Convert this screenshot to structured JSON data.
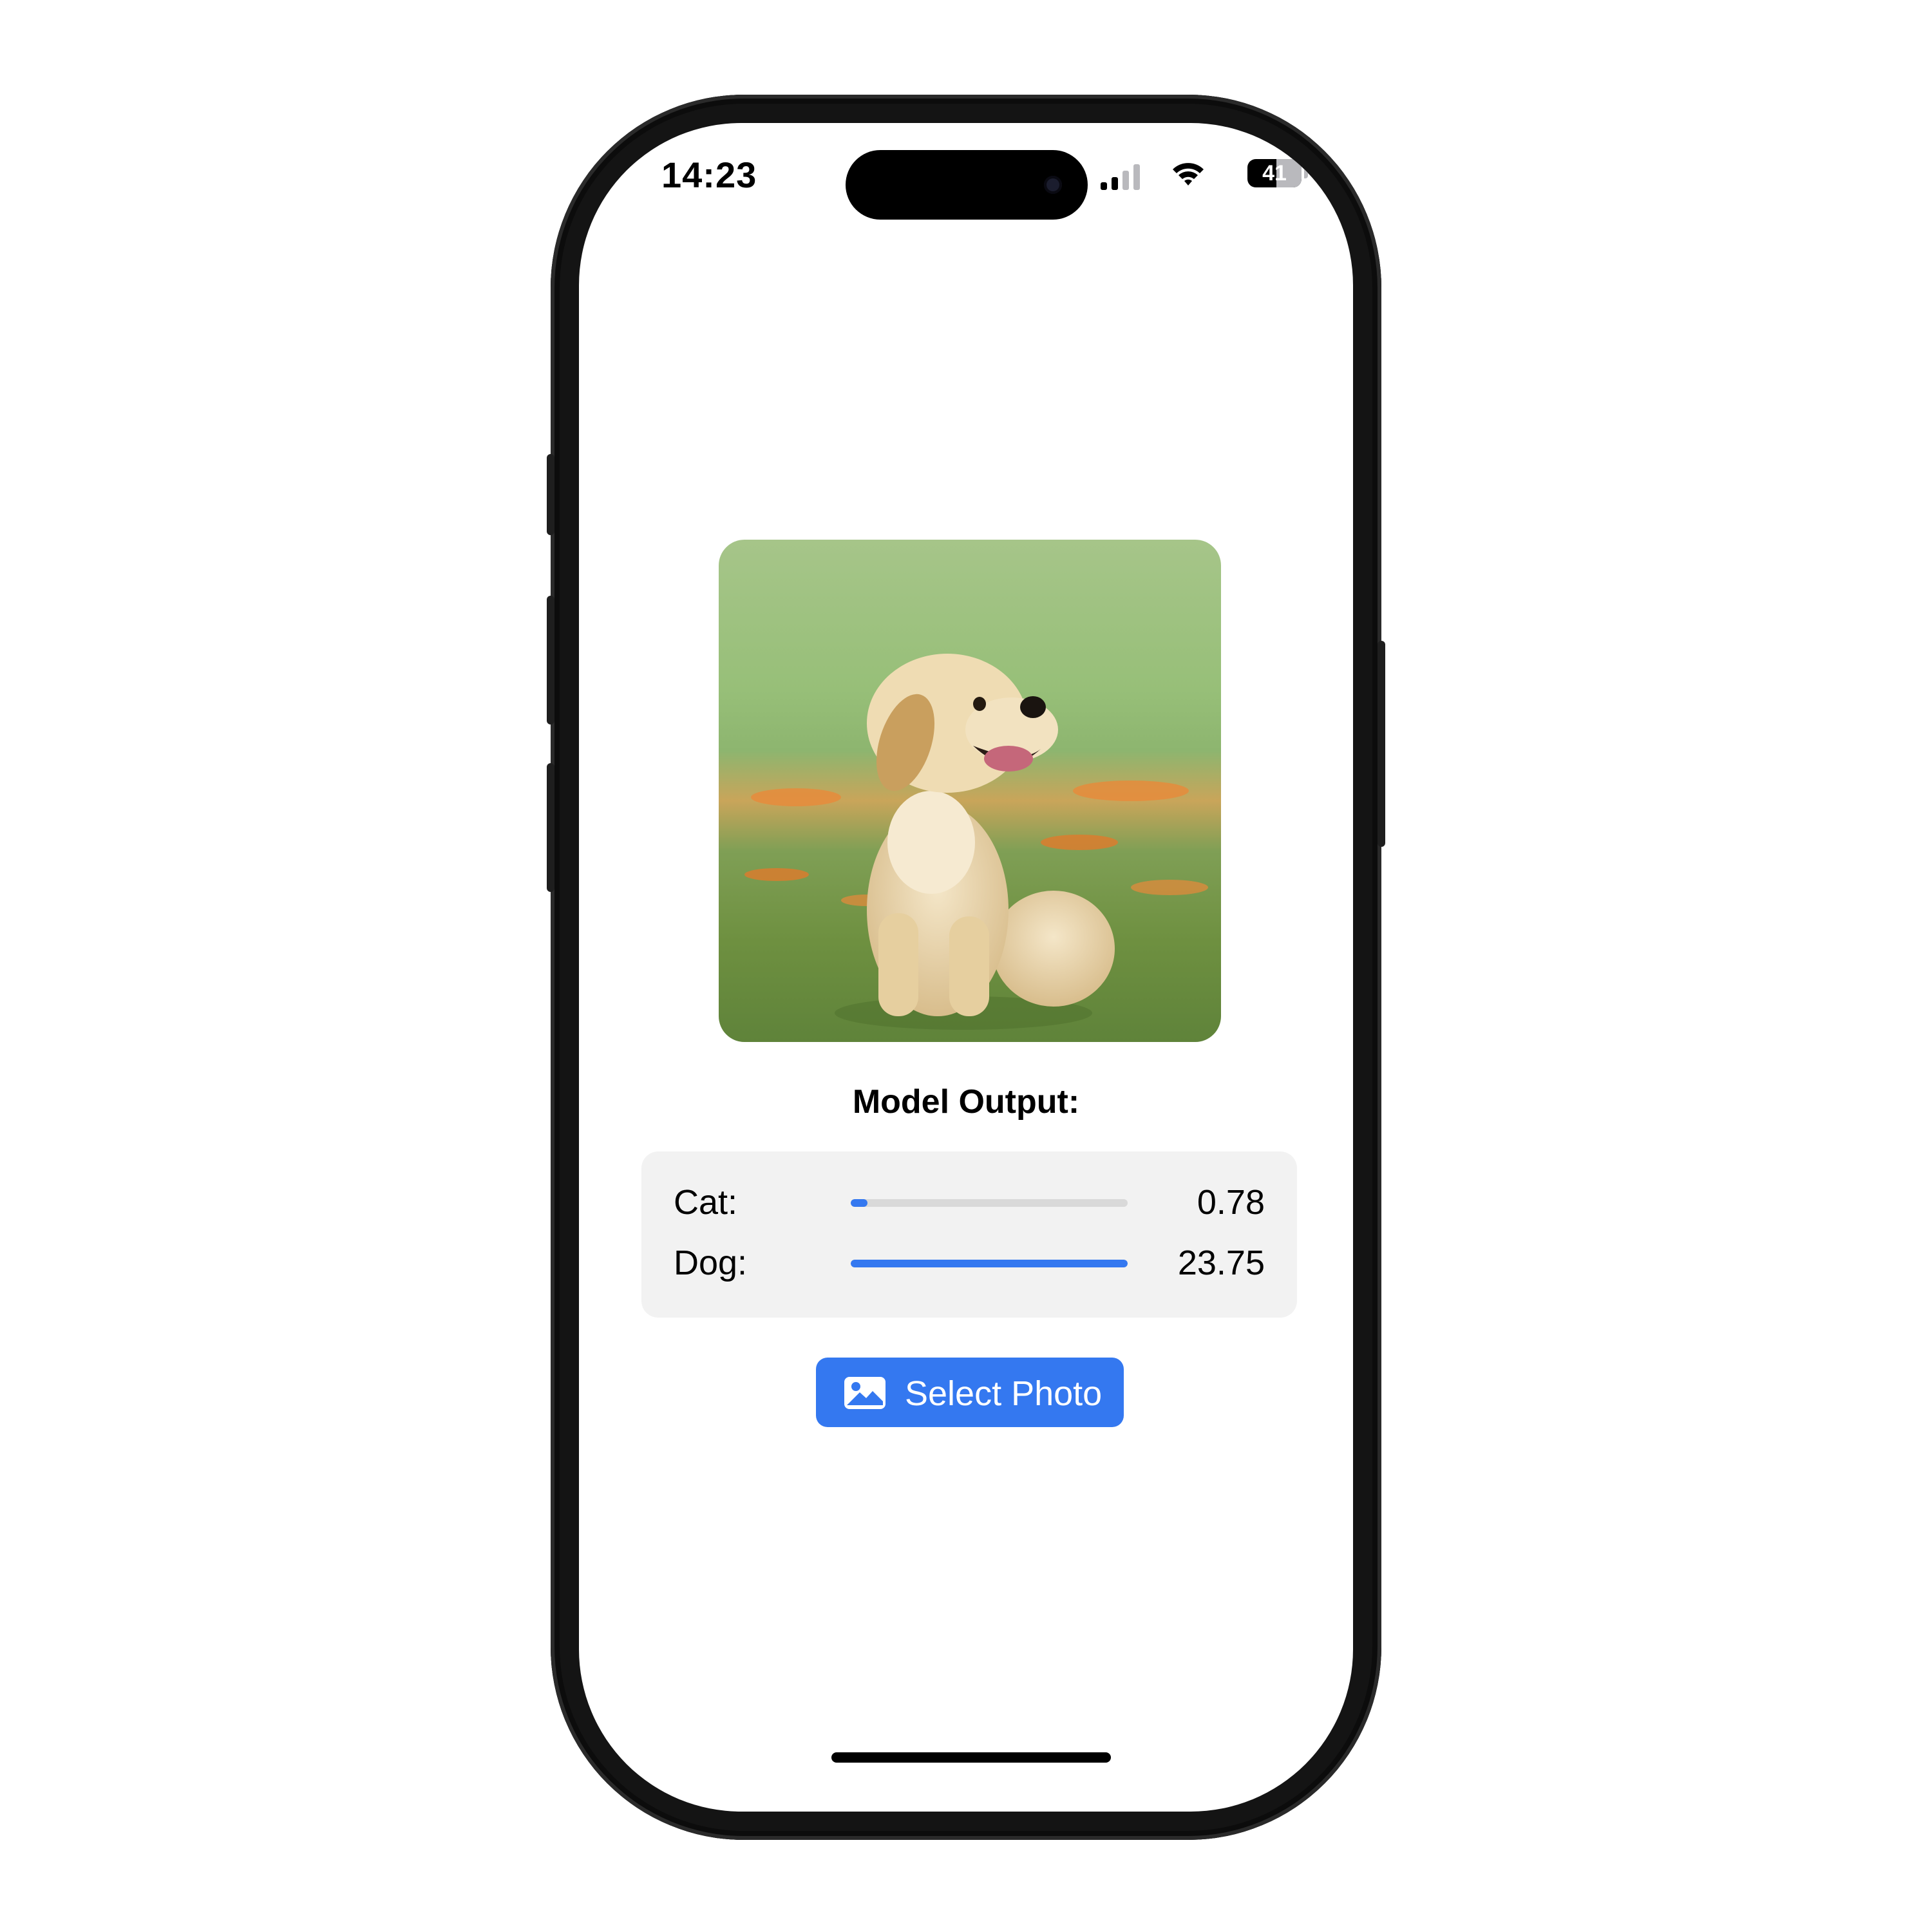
{
  "status_bar": {
    "time": "14:23",
    "battery": "41",
    "icons": [
      "cellular-signal-icon",
      "wifi-icon",
      "battery-icon"
    ]
  },
  "photo": {
    "icon": "puppy-photo",
    "description_visible": false
  },
  "model_output": {
    "title": "Model Output:",
    "results": [
      {
        "label": "Cat:",
        "value": "0.78",
        "fraction": 0.06
      },
      {
        "label": "Dog:",
        "value": "23.75",
        "fraction": 1.0
      }
    ]
  },
  "select_button": {
    "label": "Select Photo",
    "icon": "photo-icon"
  },
  "colors": {
    "accent": "#3478f0",
    "track": "#d9d9d9",
    "panel": "#f2f2f2",
    "signal_active": "#000000",
    "signal_inactive": "#b9b9bd"
  }
}
